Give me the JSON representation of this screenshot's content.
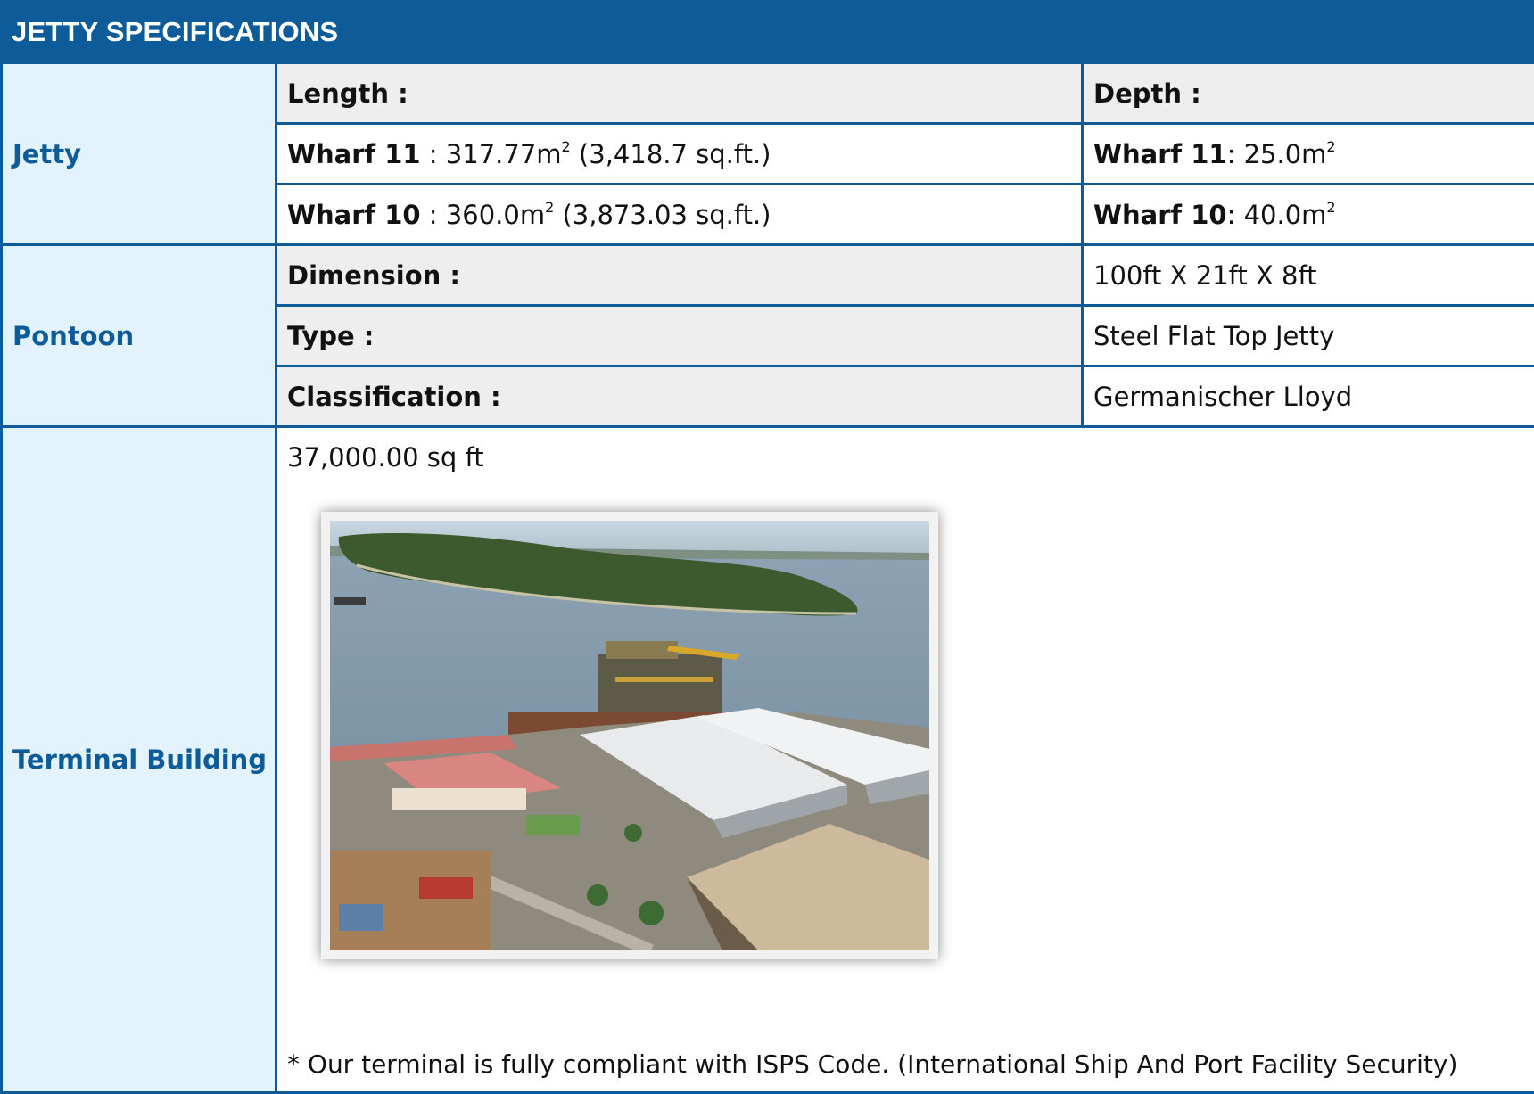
{
  "title": "JETTY SPECIFICATIONS",
  "jetty": {
    "category": "Jetty",
    "length_label": "Length :",
    "depth_label": "Depth :",
    "rows": [
      {
        "wharf": "Wharf 11",
        "length_sep": " : ",
        "length_value": "317.77m",
        "length_sup": "2",
        "length_sqft": " (3,418.7 sq.ft.)",
        "depth_sep": ": ",
        "depth_value": "25.0m",
        "depth_sup": "2"
      },
      {
        "wharf": "Wharf 10",
        "length_sep": " : ",
        "length_value": "360.0m",
        "length_sup": "2",
        "length_sqft": " (3,873.03 sq.ft.)",
        "depth_sep": ": ",
        "depth_value": "40.0m",
        "depth_sup": "2"
      }
    ]
  },
  "pontoon": {
    "category": "Pontoon",
    "rows": [
      {
        "label": "Dimension :",
        "value": "100ft X 21ft X 8ft"
      },
      {
        "label": "Type :",
        "value": "Steel Flat Top Jetty"
      },
      {
        "label": "Classification :",
        "value": "Germanischer Lloyd"
      }
    ]
  },
  "terminal": {
    "category": "Terminal Building",
    "area": "37,000.00 sq ft",
    "note": "* Our terminal is fully compliant with ISPS Code. (International Ship And Port Facility Security)"
  },
  "colors": {
    "header_bg": "#0d5b98",
    "category_bg": "#e3f3fe",
    "label_bg": "#eeeeee",
    "border": "#0d5b98"
  }
}
